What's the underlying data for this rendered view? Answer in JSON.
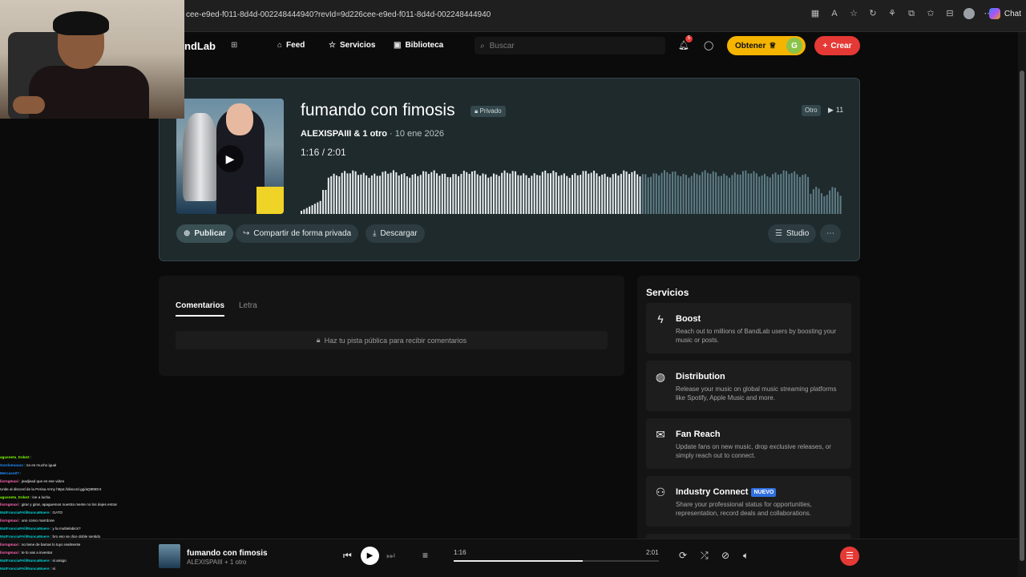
{
  "browser": {
    "url": "cee-e9ed-f011-8d4d-002248444940?revId=9d226cee-e9ed-f011-8d4d-002248444940",
    "chat_label": "Chat"
  },
  "header": {
    "logo": "ndLab",
    "nav": [
      {
        "label": "Feed",
        "icon": "home-icon"
      },
      {
        "label": "Servicios",
        "icon": "star-icon"
      },
      {
        "label": "Biblioteca",
        "icon": "library-icon"
      }
    ],
    "search_placeholder": "Buscar",
    "notification_count": "5",
    "get_label": "Obtener",
    "avatar_letter": "G",
    "create_label": "Crear"
  },
  "track": {
    "title": "fumando con fimosis",
    "privacy": "Privado",
    "artist": "ALEXISPAIII & 1 otro",
    "date": "10 ene 2026",
    "current_time": "1:16",
    "total_time": "2:01",
    "genre": "Otro",
    "plays": "11",
    "progress": 0.63,
    "buttons": {
      "publish": "Publicar",
      "share": "Compartir de forma privada",
      "download": "Descargar",
      "studio": "Studio"
    }
  },
  "comments": {
    "tabs": [
      "Comentarios",
      "Letra"
    ],
    "notice": "Haz tu pista pública para recibir comentarios"
  },
  "services": {
    "title": "Servicios",
    "items": [
      {
        "name": "Boost",
        "icon": "boost-icon",
        "desc": "Reach out to millions of BandLab users by boosting your music or posts.",
        "badge": ""
      },
      {
        "name": "Distribution",
        "icon": "distribution-icon",
        "desc": "Release your music on global music streaming platforms like Spotify, Apple Music and more.",
        "badge": ""
      },
      {
        "name": "Fan Reach",
        "icon": "mail-icon",
        "desc": "Update fans on new music, drop exclusive releases, or simply reach out to connect.",
        "badge": ""
      },
      {
        "name": "Industry Connect",
        "icon": "people-icon",
        "desc": "Share your professional status for opportunities, representation, record deals and collaborations.",
        "badge": "NUEVO"
      }
    ]
  },
  "player": {
    "title": "fumando con fimosis",
    "artist": "ALEXISPAIII + 1 otro",
    "current_time": "1:16",
    "total_time": "2:01",
    "progress": 0.63
  },
  "chat": [
    {
      "user": "agusneta_troke2",
      "msg": ":",
      "color": "#7CFC00"
    },
    {
      "user": "Gordomuuuo",
      "msg": ": no es mucho igual",
      "color": "#1E90FF"
    },
    {
      "user": "Mercaso07",
      "msg": ":",
      "color": "#1E90FF"
    },
    {
      "user": "lixrngmaxi",
      "msg": ": jeadjead que es ese video",
      "color": "#FF69B4"
    },
    {
      "user": "",
      "msg": "Unite al discord de la Perisa Army https://discord.gg/aQ9t9Dnt",
      "color": "#FF4500"
    },
    {
      "user": "agusneta_troke2",
      "msg": ": ine a lucha",
      "color": "#7CFC00"
    },
    {
      "user": "lixrngmaxi",
      "msg": ": girar y girar, apaguemos nuestra mente no los dejes entrar",
      "color": "#FF69B4"
    },
    {
      "user": "MatFranciaPAlilNuncaMuere",
      "msg": ": GATO",
      "color": "#00CED1"
    },
    {
      "user": "lixrngmaxi",
      "msg": ": uno como marrdone",
      "color": "#FF69B4"
    },
    {
      "user": "MatFranciaPAlilNuncaMuere",
      "msg": ": y la multielabics?",
      "color": "#00CED1"
    },
    {
      "user": "MatFranciaPAlilNuncaMuere",
      "msg": ": bro eso se dice doble sentido",
      "color": "#00CED1"
    },
    {
      "user": "lixrngmaxi",
      "msg": ": no tiene      de barras lo tuyo realmente",
      "color": "#FF69B4"
    },
    {
      "user": "lixrngmaxi",
      "msg": ": te lo vas a inventar",
      "color": "#FF69B4"
    },
    {
      "user": "MatFranciaPAlilNuncaMuere",
      "msg": ": si amigo",
      "color": "#00CED1"
    },
    {
      "user": "MatFranciaPAlilNuncaMuere",
      "msg": ": si",
      "color": "#00CED1"
    }
  ]
}
